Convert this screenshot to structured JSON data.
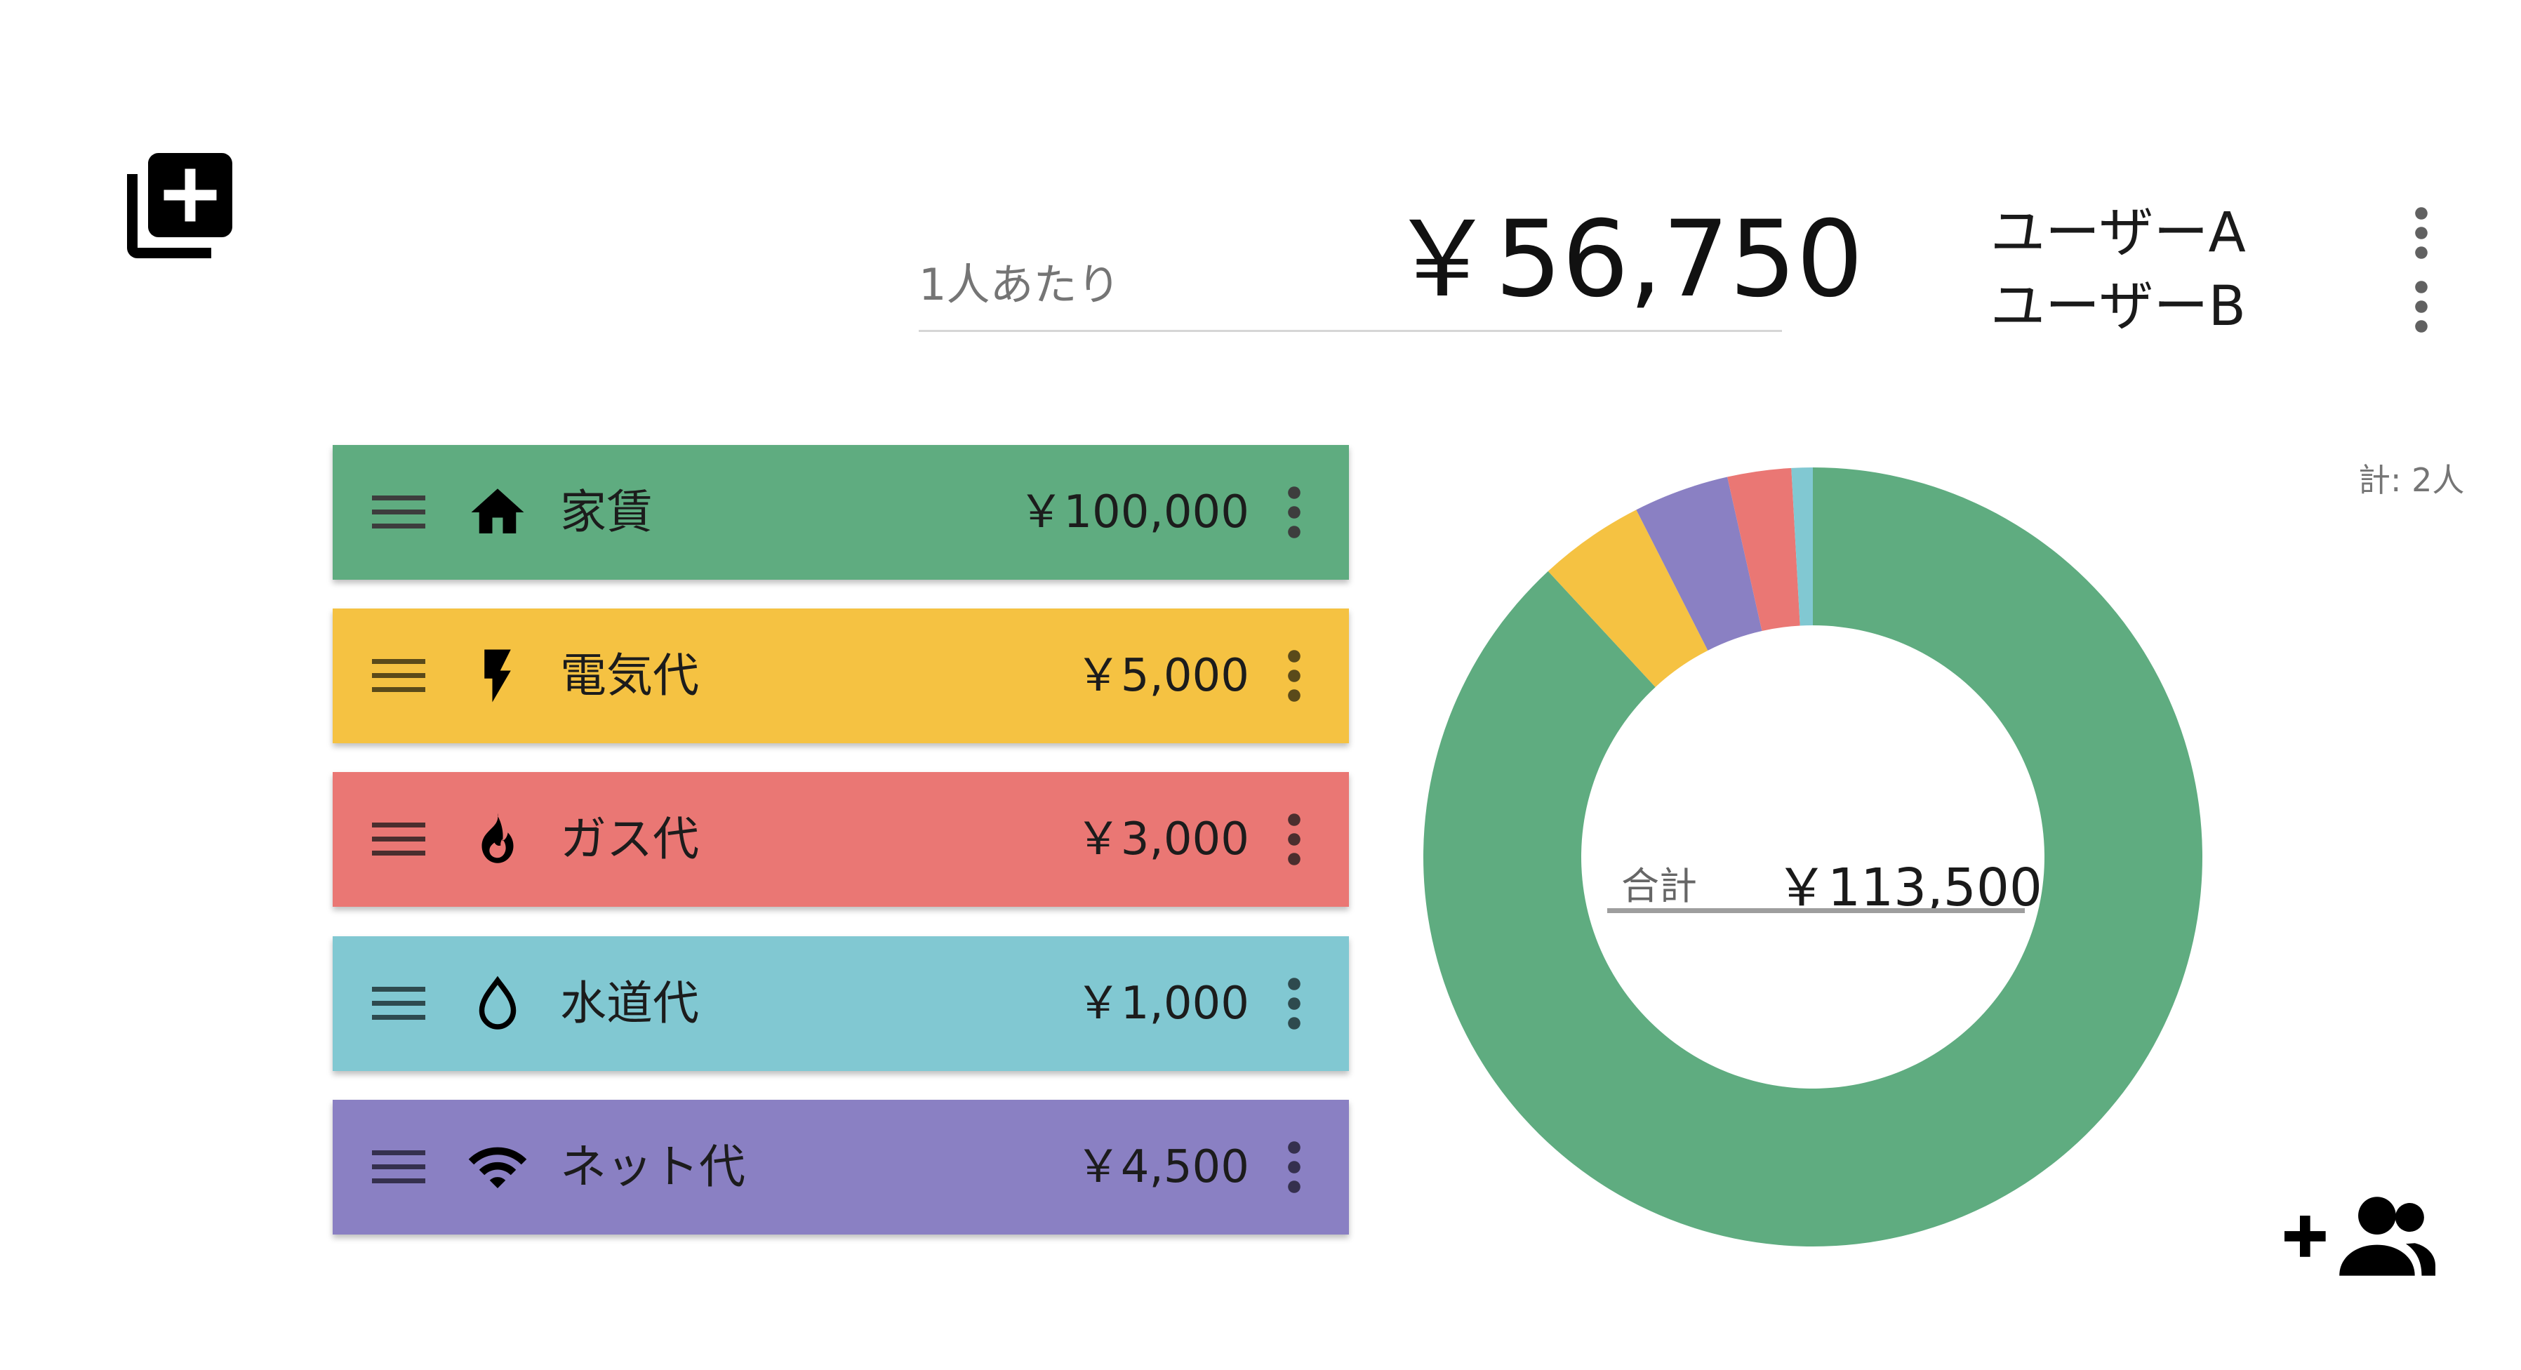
{
  "header": {
    "per_person_label": "1人あたり",
    "per_person_value": "￥56,750"
  },
  "users": [
    {
      "name": "ユーザーA"
    },
    {
      "name": "ユーザーB"
    }
  ],
  "member_count": "計: 2人",
  "expenses": [
    {
      "name": "家賃",
      "amount": "￥100,000",
      "value": 100000,
      "icon": "home-icon",
      "color": "#5fac80"
    },
    {
      "name": "電気代",
      "amount": "￥5,000",
      "value": 5000,
      "icon": "lightning-icon",
      "color": "#f5c242"
    },
    {
      "name": "ガス代",
      "amount": "￥3,000",
      "value": 3000,
      "icon": "flame-icon",
      "color": "#ea7774"
    },
    {
      "name": "水道代",
      "amount": "￥1,000",
      "value": 1000,
      "icon": "water-drop-icon",
      "color": "#81c8d2"
    },
    {
      "name": "ネット代",
      "amount": "￥4,500",
      "value": 4500,
      "icon": "wifi-icon",
      "color": "#8a80c3"
    }
  ],
  "chart_data": {
    "type": "pie",
    "donut": true,
    "categories": [
      "家賃",
      "電気代",
      "ガス代",
      "水道代",
      "ネット代"
    ],
    "values": [
      100000,
      5000,
      3000,
      1000,
      4500
    ],
    "slice_order": [
      "家賃",
      "電気代",
      "ネット代",
      "ガス代",
      "水道代"
    ],
    "colors": [
      "#5fac80",
      "#f5c242",
      "#ea7774",
      "#81c8d2",
      "#8a80c3"
    ],
    "center_label": "合計",
    "center_value": "￥113,500"
  }
}
